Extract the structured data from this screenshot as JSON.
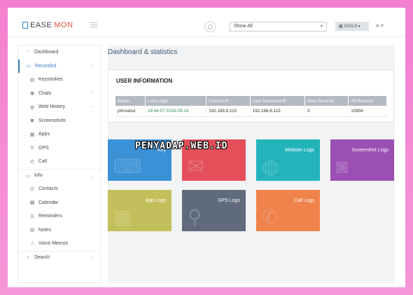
{
  "header": {
    "logo_prefix": "EASE",
    "logo_accent": "MON",
    "filter_value": "Show All",
    "date_label": "2016-9",
    "brand_color": "#2f7fb8",
    "accent_color": "#e84c3d"
  },
  "sidebar": {
    "items": [
      {
        "label": "Dashboard",
        "icon": "dashboard-icon",
        "glyph": "◔",
        "level": "top"
      },
      {
        "label": "Recorded",
        "icon": "folder-open-icon",
        "glyph": "▭",
        "level": "top",
        "active": true,
        "arrow": "‹"
      },
      {
        "label": "Keystrokes",
        "icon": "keyboard-icon",
        "glyph": "▤",
        "level": "sub"
      },
      {
        "label": "Chats",
        "icon": "chat-icon",
        "glyph": "◉",
        "level": "sub",
        "arrow": "‹"
      },
      {
        "label": "Web History",
        "icon": "globe-icon",
        "glyph": "◍",
        "level": "sub",
        "arrow": "‹"
      },
      {
        "label": "Screenshots",
        "icon": "camera-icon",
        "glyph": "◙",
        "level": "sub"
      },
      {
        "label": "Apps",
        "icon": "apps-icon",
        "glyph": "▦",
        "level": "sub"
      },
      {
        "label": "GPS",
        "icon": "map-pin-icon",
        "glyph": "⚲",
        "level": "sub"
      },
      {
        "label": "Call",
        "icon": "phone-icon",
        "glyph": "✆",
        "level": "sub"
      },
      {
        "label": "Info",
        "icon": "folder-icon",
        "glyph": "▭",
        "level": "section",
        "arrow": "⌄"
      },
      {
        "label": "Contacts",
        "icon": "contacts-icon",
        "glyph": "☰",
        "level": "sub"
      },
      {
        "label": "Calendar",
        "icon": "calendar-icon",
        "glyph": "▦",
        "level": "sub"
      },
      {
        "label": "Reminders",
        "icon": "list-icon",
        "glyph": "☰",
        "level": "sub"
      },
      {
        "label": "Notes",
        "icon": "notes-icon",
        "glyph": "▤",
        "level": "sub"
      },
      {
        "label": "Voice Memos",
        "icon": "voice-memo-icon",
        "glyph": "♫",
        "level": "sub"
      },
      {
        "label": "Search",
        "icon": "search-icon",
        "glyph": "⌕",
        "level": "section",
        "arrow": "‹"
      }
    ]
  },
  "main": {
    "title_part1": "Dashboard",
    "title_part2": " & statistics",
    "user_info": {
      "title": "USER INFORMATION",
      "columns": [
        "Name:",
        "Last Login:",
        "Current IP :",
        "Last Accessed IP :",
        "New Records:",
        "All Records:"
      ],
      "row": [
        "johnsdsd",
        "16:44:57 2016-09-14",
        "192.168.8.115",
        "192.168.8.115",
        "0",
        "10904"
      ]
    },
    "tiles": [
      {
        "label": "Key",
        "color": "#3a91d6",
        "icon": "keyboard-icon",
        "glyph": "⌨"
      },
      {
        "label": "",
        "color": "#e4505a",
        "icon": "chat-icon",
        "glyph": "✉"
      },
      {
        "label": "Website Logs",
        "color": "#23b3bc",
        "icon": "globe-icon",
        "glyph": "◍"
      },
      {
        "label": "Screenshot Logs",
        "color": "#9b4fb3",
        "icon": "camera-icon",
        "glyph": "◙"
      },
      {
        "label": "App Logs",
        "color": "#c3bf5a",
        "icon": "apps-icon",
        "glyph": "▦"
      },
      {
        "label": "GPS Logs",
        "color": "#5f6b7c",
        "icon": "map-pin-icon",
        "glyph": "⚲"
      },
      {
        "label": "Call Logs",
        "color": "#f0824b",
        "icon": "phone-icon",
        "glyph": "✆"
      }
    ]
  },
  "watermark": "PENYADAP.WEB.ID"
}
